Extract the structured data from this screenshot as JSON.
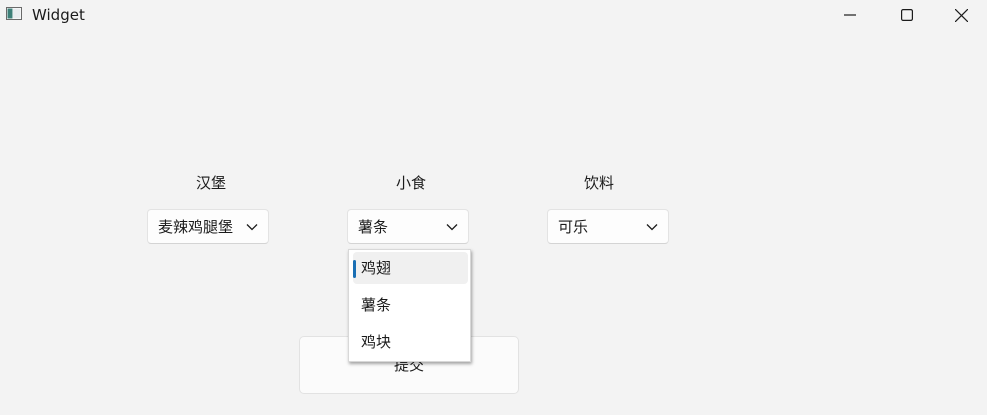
{
  "window": {
    "title": "Widget",
    "icon": "app-window-icon",
    "controls": [
      "minimize-icon",
      "maximize-icon",
      "close-icon"
    ]
  },
  "columns": [
    {
      "label": "汉堡",
      "selected": "麦辣鸡腿堡"
    },
    {
      "label": "小食",
      "selected": "薯条"
    },
    {
      "label": "饮料",
      "selected": "可乐"
    }
  ],
  "dropdown": {
    "open_for": "小食",
    "items": [
      {
        "label": "鸡翅",
        "highlighted": true
      },
      {
        "label": "薯条",
        "highlighted": false
      },
      {
        "label": "鸡块",
        "highlighted": false
      }
    ]
  },
  "submit": {
    "label": "提交"
  },
  "colors": {
    "background": "#f3f3f3",
    "accent": "#1a6fb4"
  }
}
